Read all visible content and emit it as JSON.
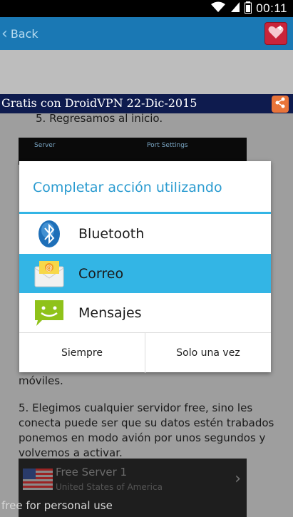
{
  "status_bar": {
    "time": "00:11",
    "icons": [
      "wifi-icon",
      "signal-icon",
      "battery-icon"
    ]
  },
  "action_bar": {
    "back_label": "Back",
    "favorite_icon": "heart-icon",
    "color": "#1a78b4"
  },
  "title_bar": {
    "text": "Gratis con DroidVPN  22-Dic-2015",
    "share_icon": "share-icon"
  },
  "content": {
    "step5": "5.  Regresamos al inicio.",
    "mini_screenshot": {
      "left_label": "Server",
      "right_label": "Port Settings"
    },
    "moviles": "móviles.",
    "paragraph": "5. Elegimos cualquier servidor free, sino les conecta puede ser que su datos estén trabados ponemos en modo avión por unos segundos y volvemos a activar.",
    "server_card": {
      "name": "Free Server 1",
      "country": "United States of America"
    },
    "watermark": "free for personal use"
  },
  "dialog": {
    "title": "Completar acción utilizando",
    "options": [
      {
        "label": "Bluetooth",
        "icon": "bluetooth-icon"
      },
      {
        "label": "Correo",
        "icon": "mail-icon",
        "selected": true
      },
      {
        "label": "Mensajes",
        "icon": "messages-icon"
      }
    ],
    "buttons": {
      "always": "Siempre",
      "once": "Solo una vez"
    },
    "accent_color": "#33b5e5"
  }
}
